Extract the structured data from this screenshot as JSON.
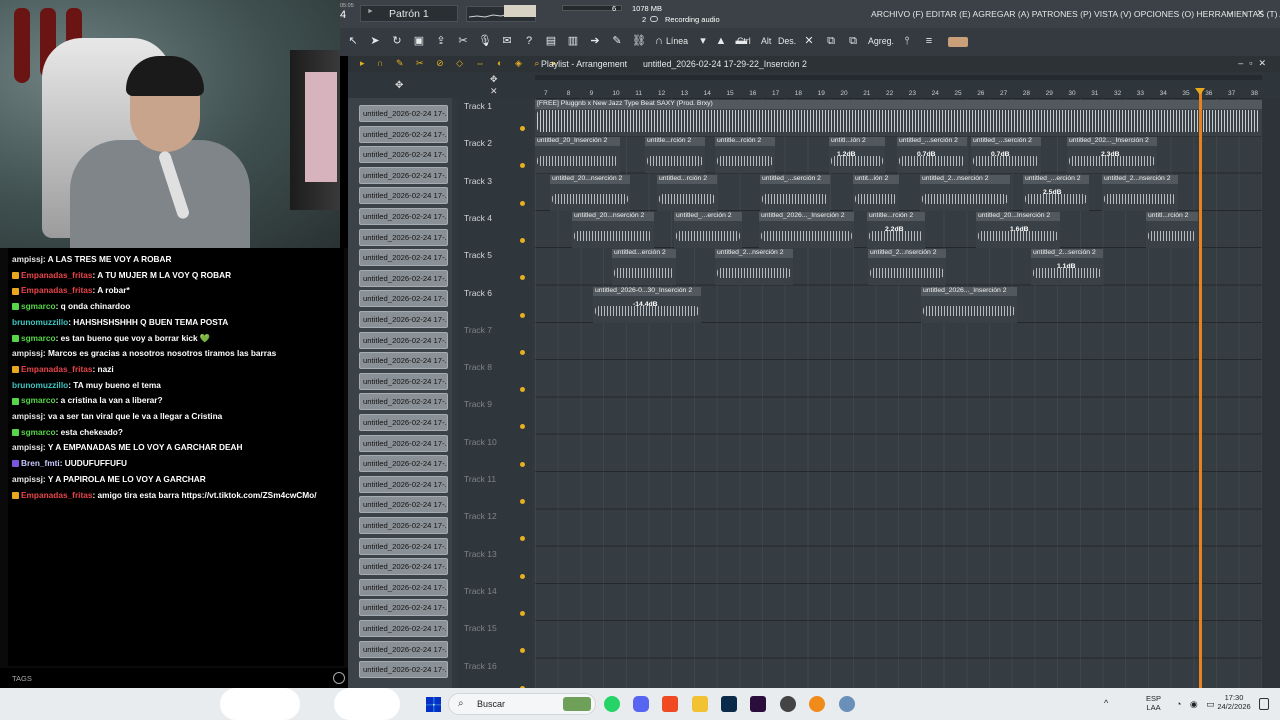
{
  "topbar": {
    "top_left_number": "4",
    "top_left_small": "05:05",
    "pattern": "Patrón 1",
    "cpu_value": "6",
    "memory": "1078 MB",
    "voices": "2",
    "status": "Recording audio",
    "menu": "ARCHIVO (F)  EDITAR (E)  AGREGAR (A)  PATRONES (P)  VISTA (V)  OPCIONES (O)  HERRAMIENTAS (T)  AYUDA"
  },
  "toolbar": {
    "line_label": "Línea",
    "ctrl": "Ctrl",
    "alt": "Alt",
    "des": "Des.",
    "agreg": "Agreg."
  },
  "playlist": {
    "title": "Playlist - Arrangement",
    "project": "untitled_2026-02-24 17-29-22_Inserción 2",
    "ruler": [
      "7",
      "8",
      "9",
      "10",
      "11",
      "12",
      "13",
      "14",
      "15",
      "16",
      "17",
      "18",
      "19",
      "20",
      "21",
      "22",
      "23",
      "24",
      "25",
      "26",
      "27",
      "28",
      "29",
      "30",
      "31",
      "32",
      "33",
      "34",
      "35",
      "36",
      "37",
      "38"
    ],
    "tracks": [
      "Track 1",
      "Track 2",
      "Track 3",
      "Track 4",
      "Track 5",
      "Track 6",
      "Track 7",
      "Track 8",
      "Track 9",
      "Track 10",
      "Track 11",
      "Track 12",
      "Track 13",
      "Track 14",
      "Track 15",
      "Track 16"
    ],
    "pattern_item": "untitled_2026-02-24 17-...",
    "clips": [
      {
        "row": 0,
        "title": "[FREE] Pluggnb x New Jazz Type Beat SAXY (Prod. Brxy)",
        "db": ""
      },
      {
        "row": 1,
        "title": "untitled_20_Inserción 2",
        "db": ""
      },
      {
        "row": 1,
        "title": "untitle...rción 2",
        "db": ""
      },
      {
        "row": 1,
        "title": "untitle...rción 2",
        "db": ""
      },
      {
        "row": 1,
        "title": "untitl...ión 2",
        "db": "1.2dB"
      },
      {
        "row": 1,
        "title": "untitled_...serción 2",
        "db": "0.7dB"
      },
      {
        "row": 1,
        "title": "untitled_...serción 2",
        "db": "0.7dB"
      },
      {
        "row": 1,
        "title": "untitled_202..._Inserción 2",
        "db": "2.3dB"
      },
      {
        "row": 2,
        "title": "untitled_20...nserción 2",
        "db": ""
      },
      {
        "row": 2,
        "title": "untitled...rción 2",
        "db": ""
      },
      {
        "row": 2,
        "title": "untitled_...serción 2",
        "db": ""
      },
      {
        "row": 2,
        "title": "untit...ión 2",
        "db": ""
      },
      {
        "row": 2,
        "title": "untitled_2...nserción 2",
        "db": ""
      },
      {
        "row": 2,
        "title": "untitled_...erción 2",
        "db": "2.5dB"
      },
      {
        "row": 2,
        "title": "untitled_2...nserción 2",
        "db": ""
      },
      {
        "row": 3,
        "title": "untitled_20...nserción 2",
        "db": ""
      },
      {
        "row": 3,
        "title": "untitled_...erción 2",
        "db": ""
      },
      {
        "row": 3,
        "title": "untitled_2026..._Inserción 2",
        "db": ""
      },
      {
        "row": 3,
        "title": "untitle...rción 2",
        "db": "2.2dB"
      },
      {
        "row": 3,
        "title": "untitled_20...Inserción 2",
        "db": "1.6dB"
      },
      {
        "row": 3,
        "title": "untitl...rción 2",
        "db": ""
      },
      {
        "row": 4,
        "title": "untitled...erción 2",
        "db": ""
      },
      {
        "row": 4,
        "title": "untitled_2...nserción 2",
        "db": ""
      },
      {
        "row": 4,
        "title": "untitled_2...nserción 2",
        "db": ""
      },
      {
        "row": 4,
        "title": "untitled_2...serción 2",
        "db": "1.1dB"
      },
      {
        "row": 5,
        "title": "untitled_2026-0...30_Inserción 2",
        "db": "-14.4dB"
      },
      {
        "row": 5,
        "title": "untitled_2026..._Inserción 2",
        "db": ""
      }
    ]
  },
  "chat": {
    "lines": [
      {
        "user": "ampissj",
        "user_color": "#e6e6e6",
        "text": ": A LAS TRES ME VOY A ROBAR",
        "badge": ""
      },
      {
        "user": "Empanadas_fritas",
        "user_color": "#e8454a",
        "text": ": A TU MUJER M LA VOY Q ROBAR",
        "badge": "#e8a81e"
      },
      {
        "user": "Empanadas_fritas",
        "user_color": "#e8454a",
        "text": ": A robar*",
        "badge": "#e8a81e"
      },
      {
        "user": "sgmarco",
        "user_color": "#58d64a",
        "text": ": q onda chinardoo",
        "badge": "#58d64a"
      },
      {
        "user": "brunomuzzillo",
        "user_color": "#3ec6c1",
        "text": ": HAHSHSHSHHH Q BUEN TEMA POSTA",
        "badge": ""
      },
      {
        "user": "sgmarco",
        "user_color": "#58d64a",
        "text": ": es tan bueno que voy a borrar kick 💚",
        "badge": "#58d64a"
      },
      {
        "user": "ampissj",
        "user_color": "#e6e6e6",
        "text": ": Marcos es gracias a nosotros nosotros tiramos las barras",
        "badge": ""
      },
      {
        "user": "Empanadas_fritas",
        "user_color": "#e8454a",
        "text": ": nazi",
        "badge": "#e8a81e"
      },
      {
        "user": "brunomuzzillo",
        "user_color": "#3ec6c1",
        "text": ": TA muy bueno el tema",
        "badge": ""
      },
      {
        "user": "sgmarco",
        "user_color": "#58d64a",
        "text": ": a cristina la van a liberar?",
        "badge": "#58d64a"
      },
      {
        "user": "ampissj",
        "user_color": "#e6e6e6",
        "text": ": va a ser tan viral que le va a llegar a Cristina",
        "badge": ""
      },
      {
        "user": "sgmarco",
        "user_color": "#58d64a",
        "text": ": esta chekeado?",
        "badge": "#58d64a"
      },
      {
        "user": "ampissj",
        "user_color": "#e6e6e6",
        "text": ": Y A EMPANADAS ME LO VOY A GARCHAR DEAH",
        "badge": ""
      },
      {
        "user": "Bren_fmti",
        "user_color": "#c8c8ff",
        "text": ": UUDUFUFFUFU",
        "badge": "#7a55e0"
      },
      {
        "user": "ampissj",
        "user_color": "#e6e6e6",
        "text": ": Y A PAPIROLA ME LO VOY A GARCHAR",
        "badge": ""
      },
      {
        "user": "Empanadas_fritas",
        "user_color": "#e8454a",
        "text": ": amigo tira esta barra https://vt.tiktok.com/ZSm4cwCMo/",
        "badge": "#e8a81e"
      }
    ],
    "tags_label": "TAGS"
  },
  "taskbar": {
    "search": "Buscar",
    "lang": "ESP",
    "lang2": "LAA",
    "time": "17:30",
    "date": "24/2/2026"
  },
  "colors": {
    "playhead": "#e8821e",
    "track_dot": "#e8b020",
    "daw_bg": "#32393e"
  }
}
